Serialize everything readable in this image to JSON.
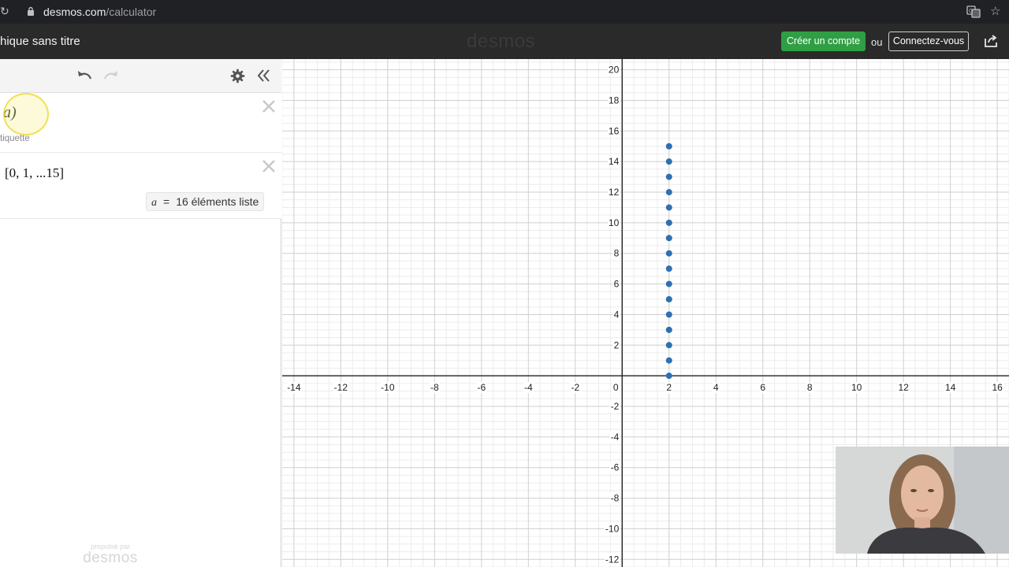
{
  "browser": {
    "url_domain": "desmos.com",
    "url_path": "/calculator"
  },
  "header": {
    "graph_title": "hique sans titre",
    "logo_text": "desmos",
    "create_account_label": "Créer un compte",
    "or_label": "ou",
    "login_label": "Connectez-vous"
  },
  "sidebar": {
    "expressions": [
      {
        "math": "a)",
        "label_hint": "tiquette"
      },
      {
        "math": "[0, 1, ...15]",
        "eval_var": "a",
        "eval_eq": "=",
        "eval_value": "16 éléments liste"
      }
    ],
    "powered_by_small": "propulsé par",
    "powered_by_logo": "desmos"
  },
  "chart_data": {
    "type": "scatter",
    "x": [
      2,
      2,
      2,
      2,
      2,
      2,
      2,
      2,
      2,
      2,
      2,
      2,
      2,
      2,
      2,
      2
    ],
    "y": [
      0,
      1,
      2,
      3,
      4,
      5,
      6,
      7,
      8,
      9,
      10,
      11,
      12,
      13,
      14,
      15
    ],
    "xlim": [
      -14.5,
      16.5
    ],
    "ylim": [
      -12.5,
      20.7
    ],
    "x_ticks": [
      -14,
      -12,
      -10,
      -8,
      -6,
      -4,
      -2,
      0,
      2,
      4,
      6,
      8,
      10,
      12,
      14,
      16
    ],
    "y_ticks": [
      -12,
      -10,
      -8,
      -6,
      -4,
      -2,
      2,
      4,
      6,
      8,
      10,
      12,
      14,
      16,
      18,
      20
    ],
    "grid": true,
    "point_color": "#2d70b3"
  },
  "colors": {
    "create_button": "#2f9e44",
    "header_bg": "#2a2a2a",
    "point": "#2d70b3"
  }
}
